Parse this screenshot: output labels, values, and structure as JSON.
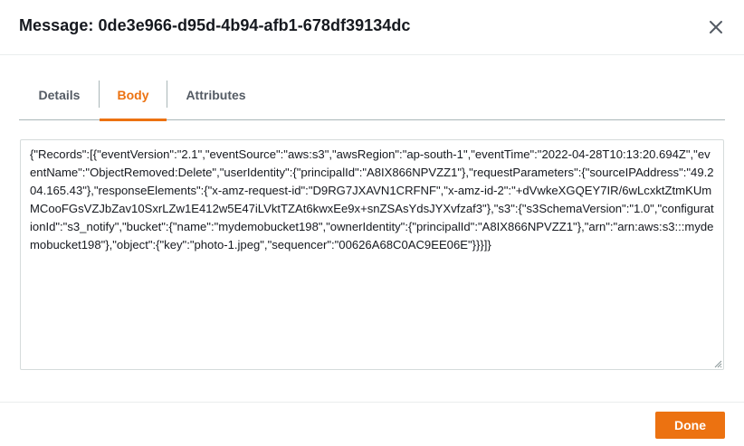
{
  "dialog": {
    "title": "Message: 0de3e966-d95d-4b94-afb1-678df39134dc"
  },
  "tabs": [
    {
      "label": "Details",
      "active": false
    },
    {
      "label": "Body",
      "active": true
    },
    {
      "label": "Attributes",
      "active": false
    }
  ],
  "body": {
    "content": "{\"Records\":[{\"eventVersion\":\"2.1\",\"eventSource\":\"aws:s3\",\"awsRegion\":\"ap-south-1\",\"eventTime\":\"2022-04-28T10:13:20.694Z\",\"eventName\":\"ObjectRemoved:Delete\",\"userIdentity\":{\"principalId\":\"A8IX866NPVZZ1\"},\"requestParameters\":{\"sourceIPAddress\":\"49.204.165.43\"},\"responseElements\":{\"x-amz-request-id\":\"D9RG7JXAVN1CRFNF\",\"x-amz-id-2\":\"+dVwkeXGQEY7IR/6wLcxktZtmKUmMCooFGsVZJbZav10SxrLZw1E412w5E47iLVktTZAt6kwxEe9x+snZSAsYdsJYXvfzaf3\"},\"s3\":{\"s3SchemaVersion\":\"1.0\",\"configurationId\":\"s3_notify\",\"bucket\":{\"name\":\"mydemobucket198\",\"ownerIdentity\":{\"principalId\":\"A8IX866NPVZZ1\"},\"arn\":\"arn:aws:s3:::mydemobucket198\"},\"object\":{\"key\":\"photo-1.jpeg\",\"sequencer\":\"00626A68C0AC9EE06E\"}}}]}"
  },
  "footer": {
    "done_label": "Done"
  },
  "icons": {
    "close": "close-icon",
    "resize": "resize-grip-icon"
  },
  "colors": {
    "accent": "#ec7211",
    "text": "#16191f",
    "tab_inactive": "#545b64"
  }
}
